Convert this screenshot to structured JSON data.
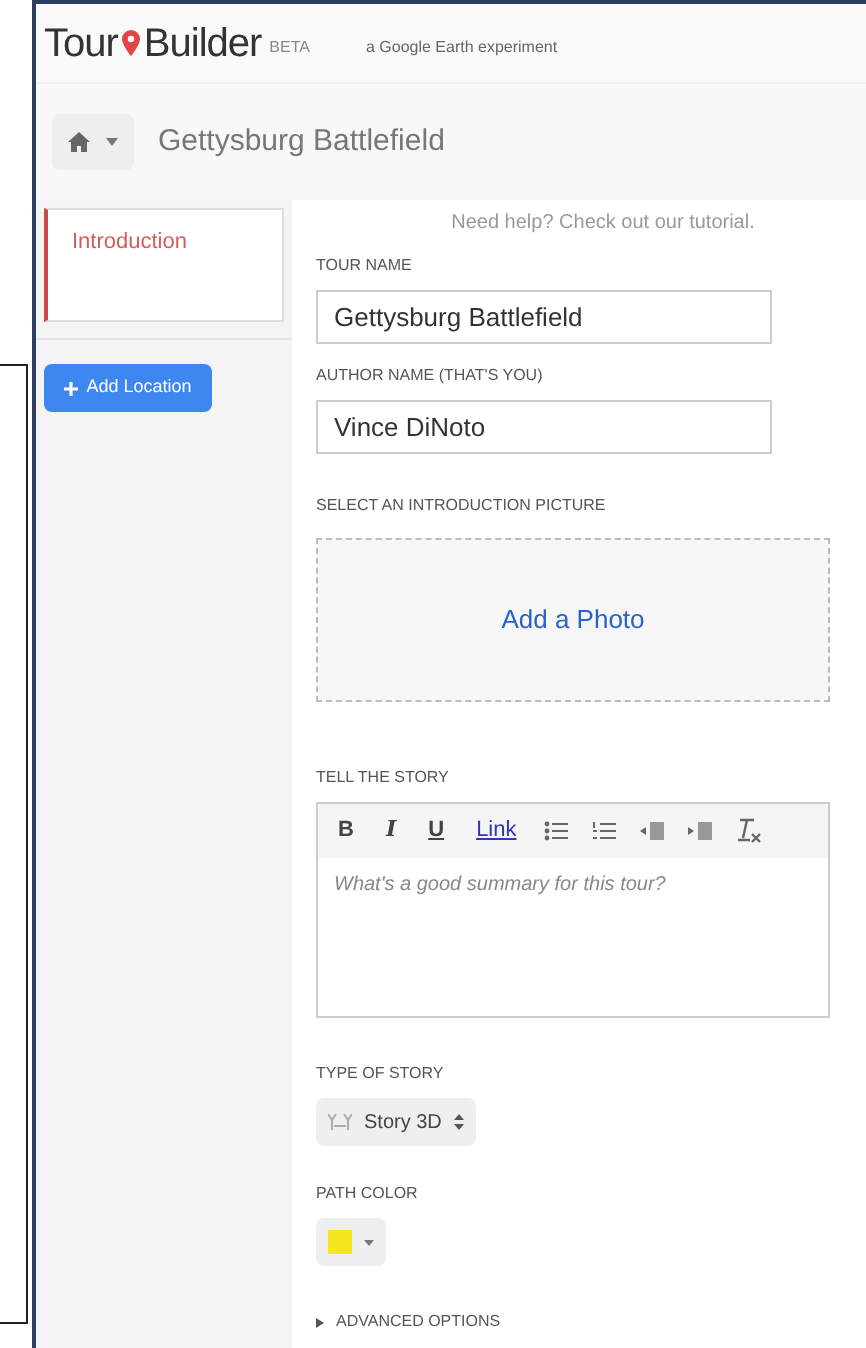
{
  "header": {
    "logo_left": "Tour",
    "logo_right": "Builder",
    "badge": "BETA",
    "tagline": "a Google Earth experiment"
  },
  "breadcrumb": {
    "title": "Gettysburg Battlefield"
  },
  "sidebar": {
    "items": [
      {
        "label": "Introduction",
        "selected": true
      }
    ],
    "add_button": "Add Location"
  },
  "form": {
    "help": "Need help? Check out our tutorial.",
    "tour_name": {
      "label": "TOUR NAME",
      "value": "Gettysburg Battlefield"
    },
    "author": {
      "label": "AUTHOR NAME (THAT'S YOU)",
      "value": "Vince DiNoto"
    },
    "picture": {
      "label": "SELECT AN INTRODUCTION PICTURE",
      "action": "Add a Photo"
    },
    "story": {
      "label": "TELL THE STORY",
      "toolbar": [
        {
          "kind": "bold",
          "text": "B"
        },
        {
          "kind": "italic",
          "text": "I"
        },
        {
          "kind": "underline",
          "text": "U"
        },
        {
          "kind": "link",
          "text": "Link"
        },
        {
          "kind": "bullets"
        },
        {
          "kind": "numbers"
        },
        {
          "kind": "outdent"
        },
        {
          "kind": "indent"
        },
        {
          "kind": "clear"
        }
      ],
      "placeholder": "What's a good summary for this tour?"
    },
    "story_type": {
      "label": "TYPE OF STORY",
      "value": "Story 3D"
    },
    "path_color": {
      "label": "PATH COLOR",
      "color": "#f5e61f"
    },
    "advanced": {
      "label": "ADVANCED OPTIONS",
      "expanded": false
    }
  }
}
